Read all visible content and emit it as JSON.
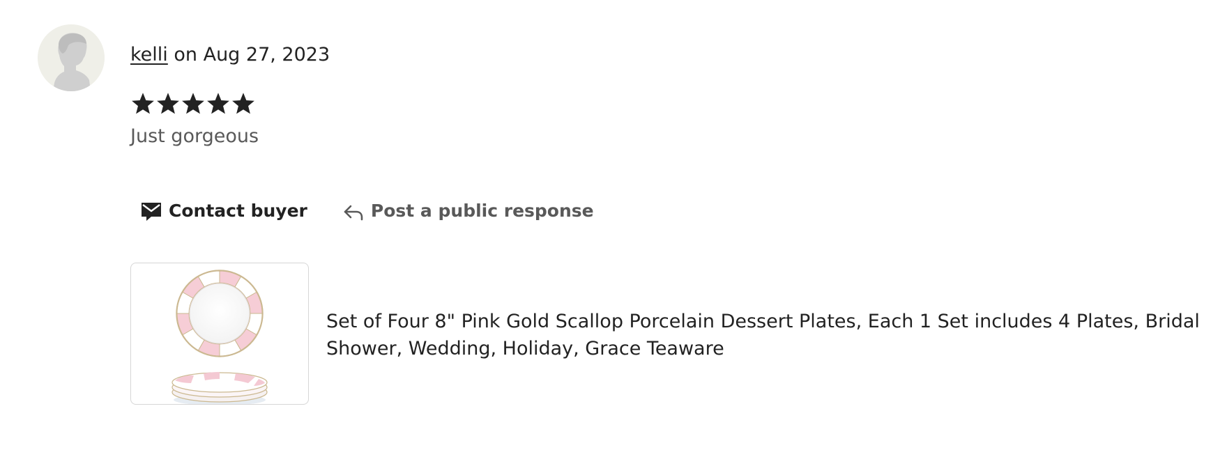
{
  "review": {
    "reviewer_name": "kelli",
    "date_text": " on Aug 27, 2023",
    "rating": 5,
    "rating_max": 5,
    "text": "Just gorgeous"
  },
  "actions": {
    "contact_label": "Contact buyer",
    "respond_label": "Post a public response"
  },
  "listing": {
    "title": "Set of Four 8\" Pink Gold Scallop Porcelain Dessert Plates, Each 1 Set includes 4 Plates, Bridal Shower, Wedding, Holiday, Grace Teaware"
  },
  "icons": {
    "avatar": "default-user-silhouette-icon",
    "star": "star-icon",
    "contact": "envelope-icon",
    "respond": "reply-arrow-icon"
  },
  "colors": {
    "text_primary": "#222222",
    "text_secondary": "#595959",
    "avatar_bg": "#efefe8",
    "thumb_border": "#d6d6d6"
  }
}
